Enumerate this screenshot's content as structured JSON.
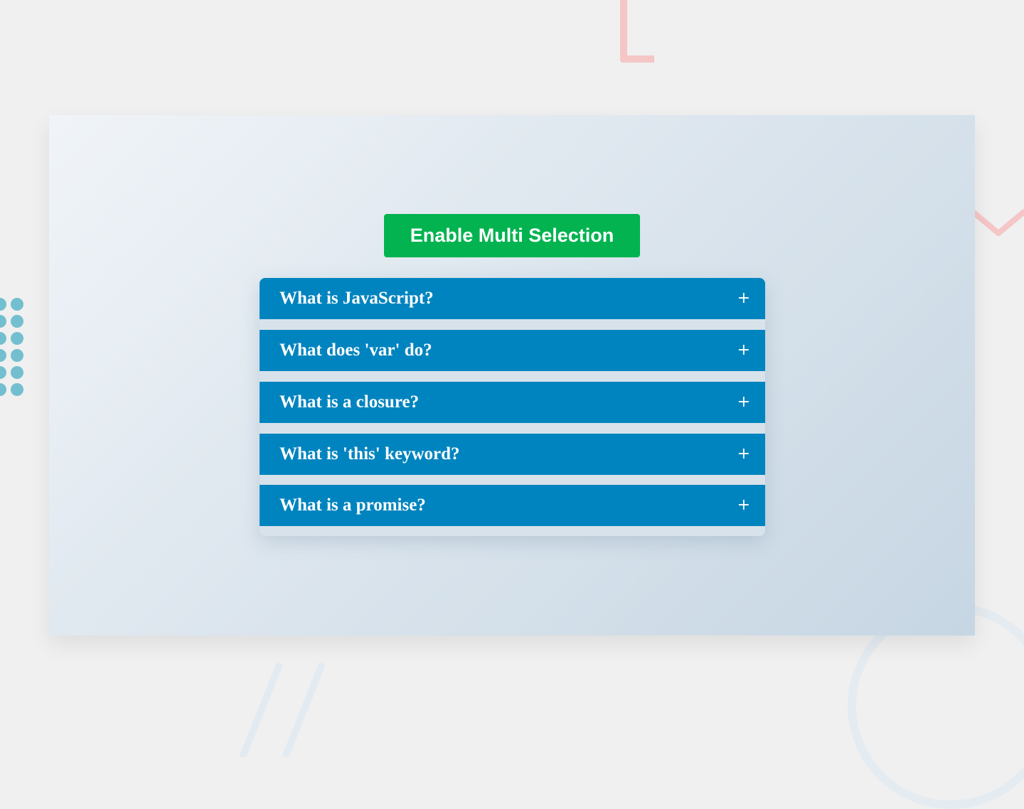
{
  "button": {
    "label": "Enable Multi Selection",
    "color": "#02b350"
  },
  "accordion": {
    "header_color": "#0084bf",
    "items": [
      {
        "question": "What is JavaScript?",
        "icon": "+",
        "icon_name": "plus-icon",
        "expanded": false
      },
      {
        "question": "What does 'var' do?",
        "icon": "+",
        "icon_name": "plus-icon",
        "expanded": false
      },
      {
        "question": "What is a closure?",
        "icon": "+",
        "icon_name": "plus-icon",
        "expanded": false
      },
      {
        "question": "What is 'this' keyword?",
        "icon": "+",
        "icon_name": "plus-icon",
        "expanded": false
      },
      {
        "question": "What is a promise?",
        "icon": "+",
        "icon_name": "plus-icon",
        "expanded": false
      }
    ]
  }
}
